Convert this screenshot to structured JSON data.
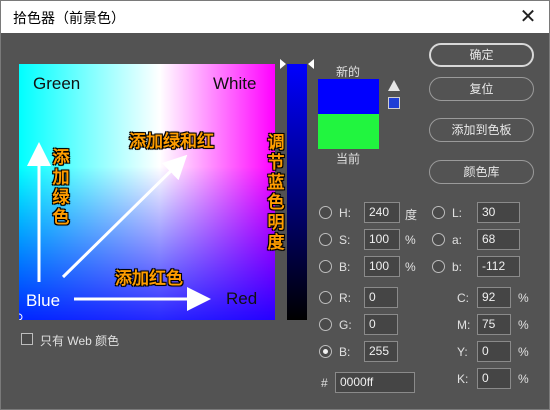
{
  "window": {
    "title": "拾色器（前景色）",
    "close_glyph": "✕"
  },
  "field": {
    "corner_green": "Green",
    "corner_white": "White",
    "corner_blue": "Blue",
    "corner_red": "Red",
    "annot_green": "添加绿色",
    "annot_green_red": "添加绿和红",
    "annot_red": "添加红色"
  },
  "slider_annotation": "调节蓝色明度",
  "swatch": {
    "new_label": "新的",
    "current_label": "当前",
    "new_color": "#0000ff",
    "current_color": "#21f53f"
  },
  "buttons": {
    "ok": "确定",
    "reset": "复位",
    "add_to_swatches": "添加到色板",
    "color_libraries": "颜色库"
  },
  "hsb": [
    {
      "label": "H:",
      "value": "240",
      "unit": "度"
    },
    {
      "label": "S:",
      "value": "100",
      "unit": "%"
    },
    {
      "label": "B:",
      "value": "100",
      "unit": "%"
    }
  ],
  "lab": [
    {
      "label": "L:",
      "value": "30"
    },
    {
      "label": "a:",
      "value": "68"
    },
    {
      "label": "b:",
      "value": "-112"
    }
  ],
  "rgb": [
    {
      "label": "R:",
      "value": "0"
    },
    {
      "label": "G:",
      "value": "0"
    },
    {
      "label": "B:",
      "value": "255"
    }
  ],
  "cmyk": [
    {
      "label": "C:",
      "value": "92",
      "unit": "%"
    },
    {
      "label": "M:",
      "value": "75",
      "unit": "%"
    },
    {
      "label": "Y:",
      "value": "0",
      "unit": "%"
    },
    {
      "label": "K:",
      "value": "0",
      "unit": "%"
    }
  ],
  "hex": {
    "label": "#",
    "value": "0000ff"
  },
  "web_only": {
    "label": "只有 Web 颜色",
    "checked": false
  },
  "selected_radio": "rgb-b",
  "colors": {
    "panel_bg": "#535353",
    "annotation": "#ff9d00",
    "arrow": "#ffffff"
  }
}
